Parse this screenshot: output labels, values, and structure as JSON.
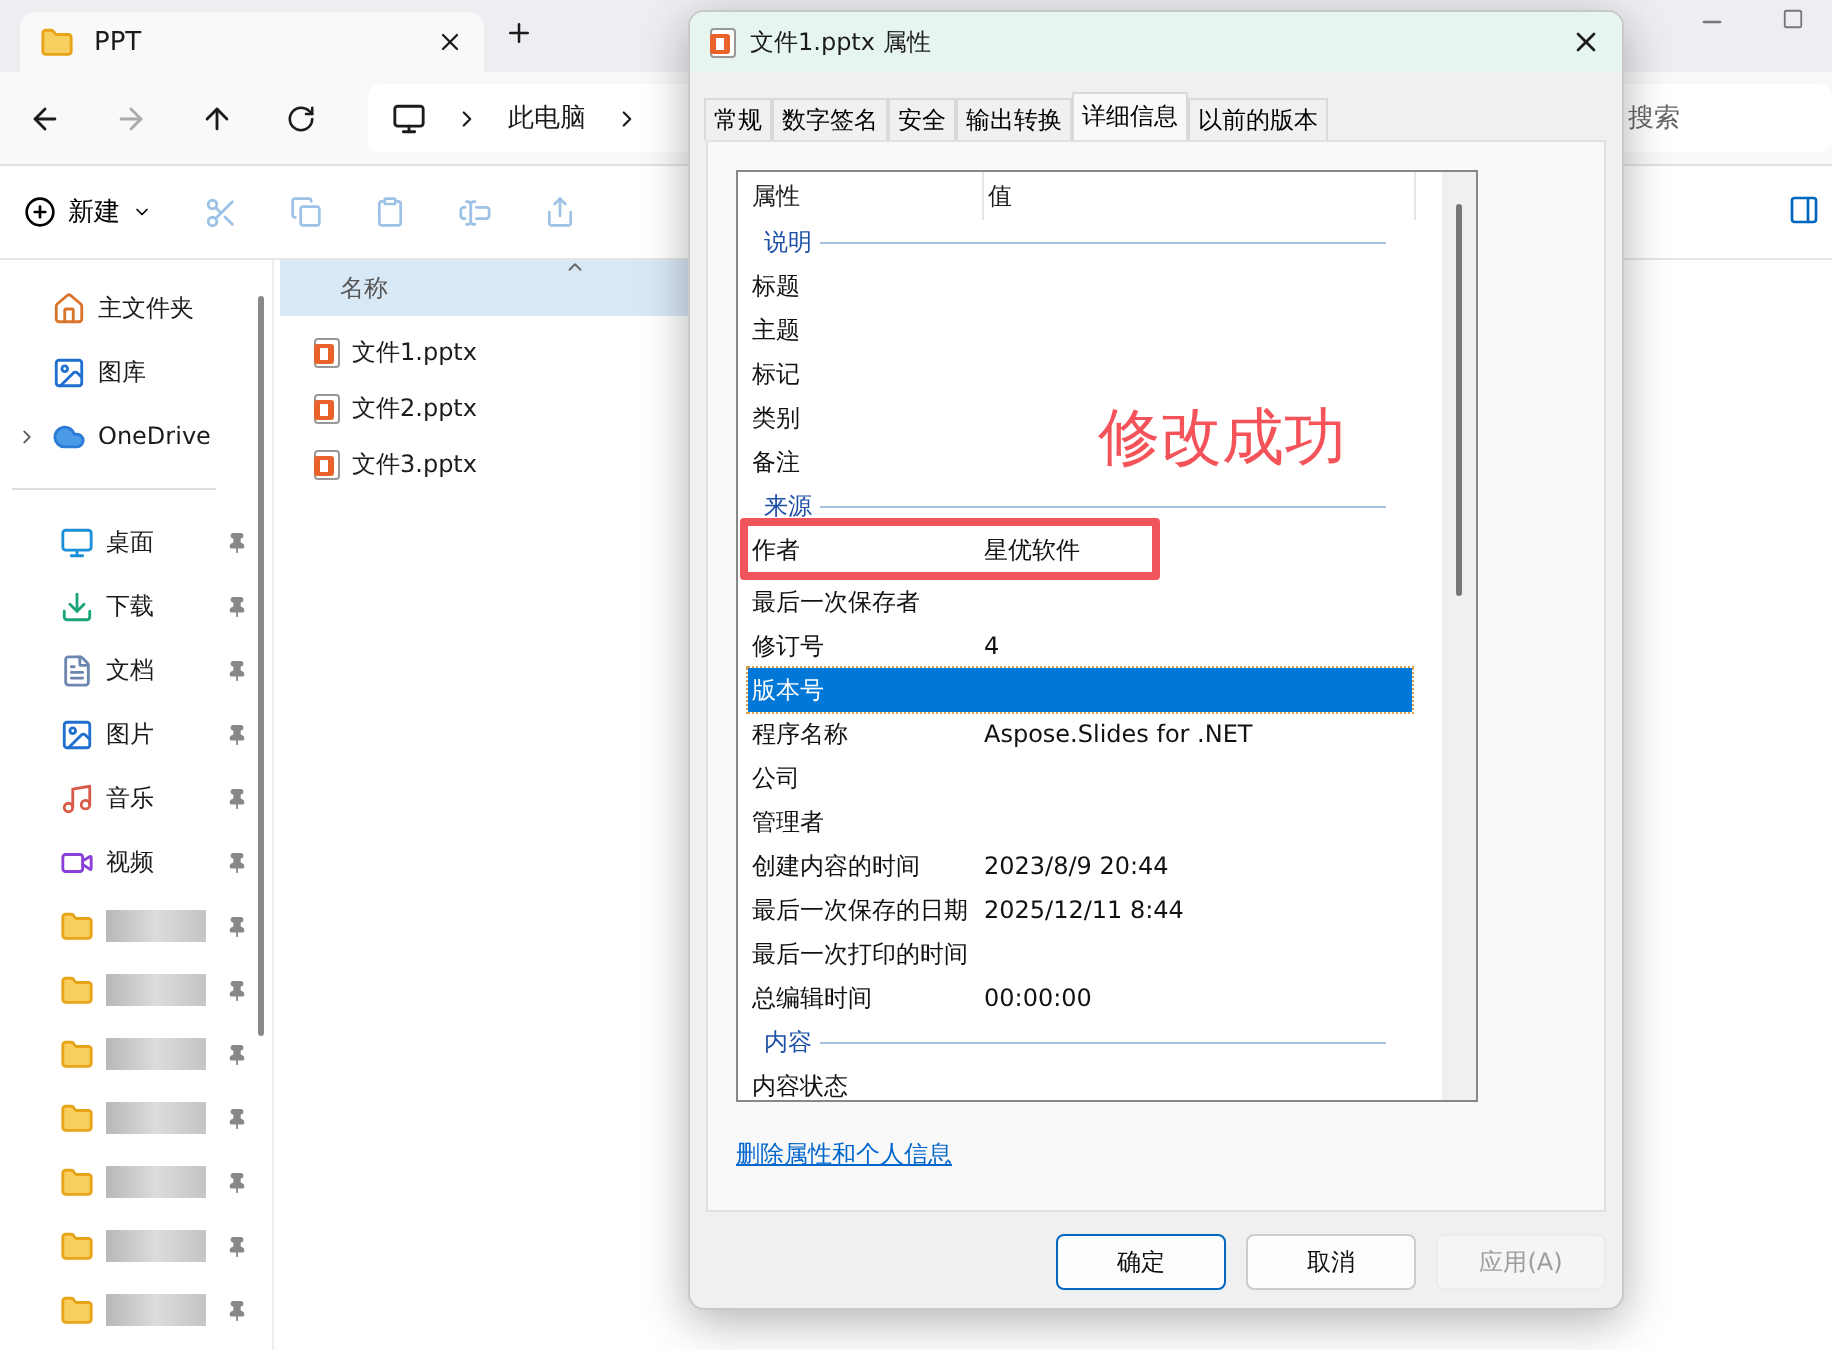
{
  "explorer": {
    "tab": {
      "title": "PPT"
    },
    "breadcrumb": [
      "此电脑"
    ],
    "search": {
      "placeholder": "搜索"
    },
    "toolbar": {
      "new_label": "新建"
    },
    "sidebar": {
      "top_items": [
        {
          "label": "主文件夹",
          "kind": "home",
          "expandable": false
        },
        {
          "label": "图库",
          "kind": "gallery",
          "expandable": false
        },
        {
          "label": "OneDrive",
          "kind": "cloud",
          "expandable": true
        }
      ],
      "pinned_items": [
        {
          "label": "桌面",
          "kind": "desktop"
        },
        {
          "label": "下载",
          "kind": "download"
        },
        {
          "label": "文档",
          "kind": "document"
        },
        {
          "label": "图片",
          "kind": "picture"
        },
        {
          "label": "音乐",
          "kind": "music"
        },
        {
          "label": "视频",
          "kind": "video"
        },
        {
          "kind": "folder"
        },
        {
          "kind": "folder"
        },
        {
          "kind": "folder"
        },
        {
          "kind": "folder"
        },
        {
          "kind": "folder"
        },
        {
          "kind": "folder"
        },
        {
          "kind": "folder"
        }
      ]
    },
    "file_list": {
      "column": "名称",
      "files": [
        "文件1.pptx",
        "文件2.pptx",
        "文件3.pptx"
      ]
    }
  },
  "dialog": {
    "title": "文件1.pptx 属性",
    "tabs": [
      {
        "label": "常规",
        "selected": false
      },
      {
        "label": "数字签名",
        "selected": false
      },
      {
        "label": "安全",
        "selected": false
      },
      {
        "label": "输出转换",
        "selected": false
      },
      {
        "label": "详细信息",
        "selected": true
      },
      {
        "label": "以前的版本",
        "selected": false
      }
    ],
    "columns": [
      "属性",
      "值"
    ],
    "rows": [
      {
        "kind": "section",
        "label": "说明"
      },
      {
        "kind": "property",
        "name": "标题",
        "selected": false,
        "highlighted": false
      },
      {
        "kind": "property",
        "name": "主题",
        "selected": false,
        "highlighted": false
      },
      {
        "kind": "property",
        "name": "标记",
        "selected": false,
        "highlighted": false
      },
      {
        "kind": "property",
        "name": "类别",
        "selected": false,
        "highlighted": false
      },
      {
        "kind": "property",
        "name": "备注",
        "selected": false,
        "highlighted": false
      },
      {
        "kind": "section",
        "label": "来源"
      },
      {
        "kind": "property",
        "name": "作者",
        "value": "星优软件",
        "selected": false,
        "highlighted": true
      },
      {
        "kind": "property",
        "name": "最后一次保存者",
        "selected": false,
        "highlighted": false
      },
      {
        "kind": "property",
        "name": "修订号",
        "value": "4",
        "selected": false,
        "highlighted": false
      },
      {
        "kind": "property",
        "name": "版本号",
        "selected": true,
        "highlighted": false
      },
      {
        "kind": "property",
        "name": "程序名称",
        "value": "Aspose.Slides for .NET",
        "selected": false,
        "highlighted": false
      },
      {
        "kind": "property",
        "name": "公司",
        "selected": false,
        "highlighted": false
      },
      {
        "kind": "property",
        "name": "管理者",
        "selected": false,
        "highlighted": false
      },
      {
        "kind": "property",
        "name": "创建内容的时间",
        "value": "2023/8/9 20:44",
        "selected": false,
        "highlighted": false
      },
      {
        "kind": "property",
        "name": "最后一次保存的日期",
        "value": "2025/12/11 8:44",
        "selected": false,
        "highlighted": false
      },
      {
        "kind": "property",
        "name": "最后一次打印的时间",
        "selected": false,
        "highlighted": false
      },
      {
        "kind": "property",
        "name": "总编辑时间",
        "value": "00:00:00",
        "selected": false,
        "highlighted": false
      },
      {
        "kind": "section",
        "label": "内容"
      },
      {
        "kind": "property",
        "name": "内容状态",
        "selected": false,
        "highlighted": false
      }
    ],
    "annotation": "修改成功",
    "link": "删除属性和个人信息",
    "buttons": [
      {
        "label": "确定",
        "default": true,
        "disabled": false
      },
      {
        "label": "取消",
        "default": false,
        "disabled": false
      },
      {
        "label": "应用(A)",
        "default": false,
        "disabled": true
      }
    ]
  }
}
